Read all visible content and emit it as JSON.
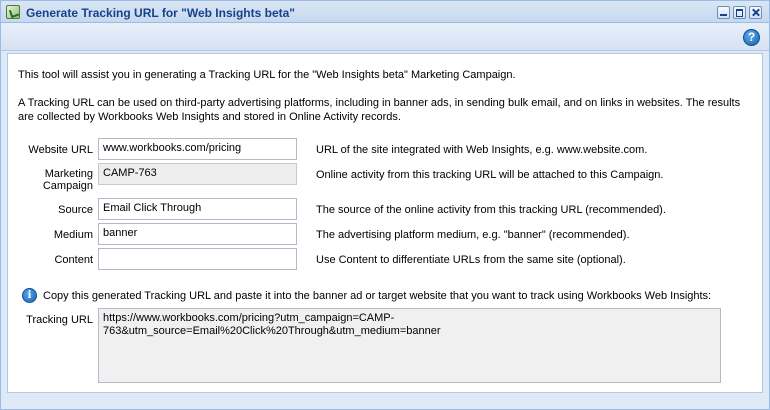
{
  "window": {
    "title": "Generate Tracking URL for \"Web Insights beta\""
  },
  "intro": {
    "line1": "This tool will assist you in generating a Tracking URL for the \"Web Insights beta\" Marketing Campaign.",
    "line2": "A Tracking URL can be used on third-party advertising platforms, including in banner ads, in sending bulk email, and on links in websites. The results are collected by Workbooks Web Insights and stored in Online Activity records."
  },
  "form": {
    "website_url": {
      "label": "Website URL",
      "value": "www.workbooks.com/pricing",
      "hint": "URL of the site integrated with Web Insights, e.g. www.website.com."
    },
    "marketing_campaign": {
      "label_line1": "Marketing",
      "label_line2": "Campaign",
      "value": "CAMP-763",
      "hint": "Online activity from this tracking URL will be attached to this Campaign."
    },
    "source": {
      "label": "Source",
      "value": "Email Click Through",
      "hint": "The source of the online activity from this tracking URL (recommended)."
    },
    "medium": {
      "label": "Medium",
      "value": "banner",
      "hint": "The advertising platform medium, e.g. \"banner\" (recommended)."
    },
    "content": {
      "label": "Content",
      "value": "",
      "hint": "Use Content to differentiate URLs from the same site (optional)."
    }
  },
  "info": {
    "text": "Copy this generated Tracking URL and paste it into the banner ad or target website that you want to track using Workbooks Web Insights:"
  },
  "tracking_url": {
    "label": "Tracking URL",
    "line1": "https://www.workbooks.com/pricing?utm_campaign=CAMP-",
    "line2": "763&utm_source=Email%20Click%20Through&utm_medium=banner"
  },
  "icons": {
    "app": "app-icon",
    "help": "help-icon",
    "info": "info-icon",
    "minimize": "minimize-icon",
    "maximize": "maximize-icon",
    "close": "close-icon"
  }
}
